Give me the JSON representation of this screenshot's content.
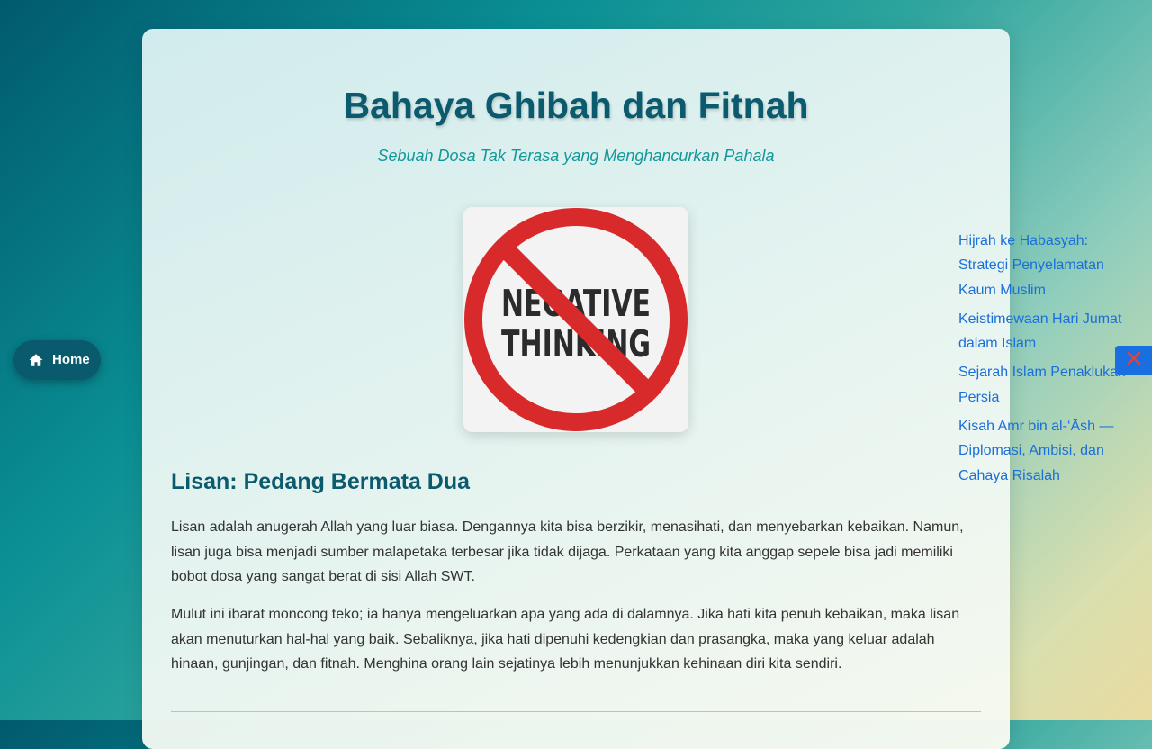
{
  "article": {
    "title": "Bahaya Ghibah dan Fitnah",
    "subtitle": "Sebuah Dosa Tak Terasa yang Menghancurkan Pahala",
    "image": {
      "line1": "NEGATIVE",
      "line2": "THINKING",
      "ring_color": "#d82a2a"
    },
    "section_heading": "Lisan: Pedang Bermata Dua",
    "paragraphs": [
      "Lisan adalah anugerah Allah yang luar biasa. Dengannya kita bisa berzikir, menasihati, dan menyebarkan kebaikan. Namun, lisan juga bisa menjadi sumber malapetaka terbesar jika tidak dijaga. Perkataan yang kita anggap sepele bisa jadi memiliki bobot dosa yang sangat berat di sisi Allah SWT.",
      "Mulut ini ibarat moncong teko; ia hanya mengeluarkan apa yang ada di dalamnya. Jika hati kita penuh kebaikan, maka lisan akan menuturkan hal-hal yang baik. Sebaliknya, jika hati dipenuhi kedengkian dan prasangka, maka yang keluar adalah hinaan, gunjingan, dan fitnah. Menghina orang lain sejatinya lebih menunjukkan kehinaan diri kita sendiri."
    ]
  },
  "nav": {
    "home_label": "Home",
    "home_icon": "home-icon"
  },
  "related_links": [
    "Hijrah ke Habasyah: Strategi Penyelamatan Kaum Muslim",
    "Keistimewaan Hari Jumat dalam Islam",
    "Sejarah Islam Penaklukan Persia",
    "Kisah Amr bin al-‘Āsh — Diplomasi, Ambisi, dan Cahaya Risalah"
  ],
  "close_icon": "close-icon",
  "colors": {
    "heading": "#0b5a6e",
    "subtitle": "#12979a",
    "link": "#1b6fd9",
    "close_button": "#1a6fe0",
    "home_button": "#0a5a6d"
  }
}
